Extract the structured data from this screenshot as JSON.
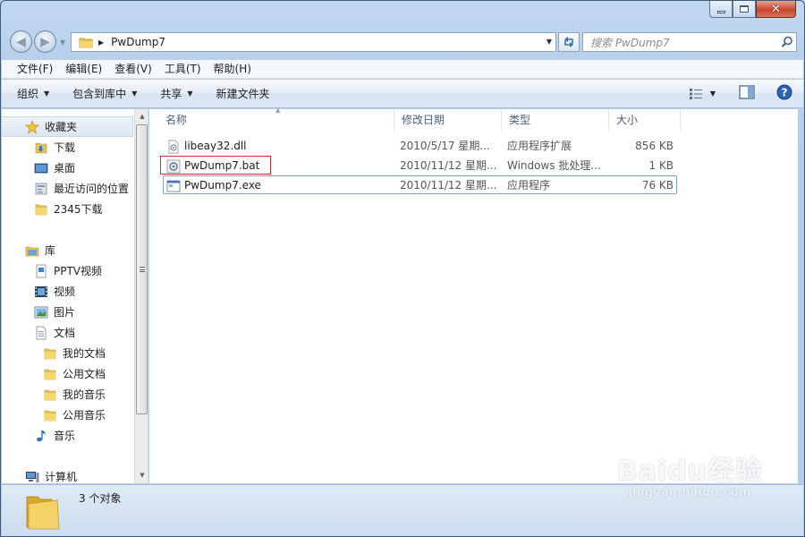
{
  "window": {
    "title": "PwDump7"
  },
  "address": {
    "path": "PwDump7"
  },
  "search": {
    "placeholder": "搜索 PwDump7"
  },
  "menu": [
    "文件(F)",
    "编辑(E)",
    "查看(V)",
    "工具(T)",
    "帮助(H)"
  ],
  "toolbar": {
    "organize": "组织",
    "include_in_library": "包含到库中",
    "share": "共享",
    "new_folder": "新建文件夹"
  },
  "nav": {
    "favorites": {
      "label": "收藏夹",
      "items": [
        "下载",
        "桌面",
        "最近访问的位置",
        "2345下载"
      ]
    },
    "libraries": {
      "label": "库",
      "items": [
        "PPTV视频",
        "视频",
        "图片",
        "文档",
        "我的文档",
        "公用文档",
        "我的音乐",
        "公用音乐",
        "音乐"
      ]
    },
    "computer": {
      "label": "计算机"
    }
  },
  "columns": {
    "name": "名称",
    "date": "修改日期",
    "type": "类型",
    "size": "大小"
  },
  "files": [
    {
      "name": "libeay32.dll",
      "date": "2010/5/17 星期...",
      "type": "应用程序扩展",
      "size": "856 KB",
      "icon": "dll-icon"
    },
    {
      "name": "PwDump7.bat",
      "date": "2010/11/12 星期...",
      "type": "Windows 批处理...",
      "size": "1 KB",
      "icon": "batch-file-icon"
    },
    {
      "name": "PwDump7.exe",
      "date": "2010/11/12 星期...",
      "type": "应用程序",
      "size": "76 KB",
      "icon": "exe-icon"
    }
  ],
  "status": {
    "count": "3 个对象"
  },
  "watermark": {
    "logo": "Baidu经验",
    "url": "jingyan.baidu.com"
  },
  "colors": {
    "highlight_box": "#d32b2b",
    "window_frame": "#b9d1ea",
    "focus_border": "#7da2ce"
  }
}
